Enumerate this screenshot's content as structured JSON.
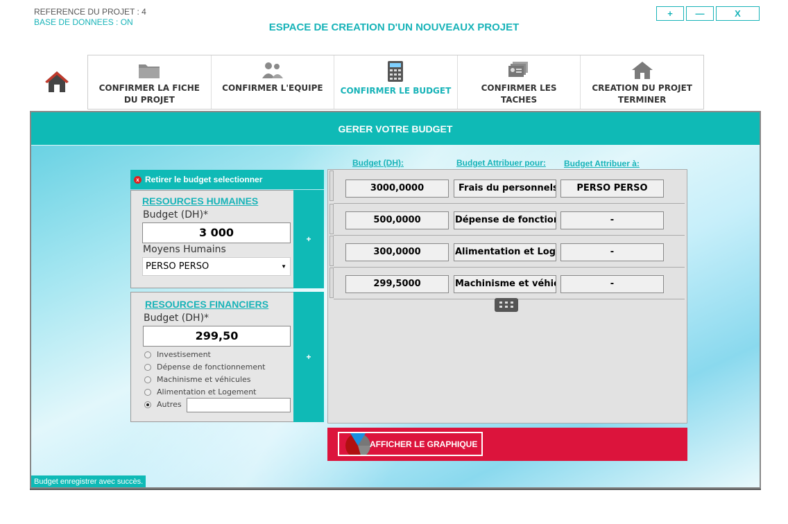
{
  "header": {
    "reference": "REFERENCE DU PROJET : 4",
    "database": "BASE DE DONNEES : ON",
    "title": "ESPACE DE CREATION D'UN NOUVEAUX PROJET"
  },
  "window_buttons": {
    "add": "+",
    "minimize": "—",
    "close": "X"
  },
  "nav": {
    "home_icon": "home-icon",
    "tabs": [
      {
        "label": "CONFIRMER LA FICHE DU PROJET",
        "icon": "folder-icon",
        "active": false
      },
      {
        "label": "CONFIRMER L'EQUIPE",
        "icon": "team-icon",
        "active": false
      },
      {
        "label": "CONFIRMER LE BUDGET",
        "icon": "calculator-icon",
        "active": true
      },
      {
        "label": "CONFIRMER LES TACHES",
        "icon": "tasks-icon",
        "active": false
      },
      {
        "label": "CREATION DU PROJET TERMINER",
        "icon": "house-icon",
        "active": false
      }
    ]
  },
  "panel": {
    "title": "GERER VOTRE BUDGET",
    "remove_label": "Retirer le budget selectionner",
    "human": {
      "title": "RESOURCES HUMAINES",
      "budget_label": "Budget (DH)*",
      "budget_value": "3 000",
      "means_label": "Moyens Humains",
      "means_value": "PERSO PERSO",
      "add": "+"
    },
    "financial": {
      "title": "RESOURCES FINANCIERS",
      "budget_label": "Budget (DH)*",
      "budget_value": "299,50",
      "options": [
        "Investisement",
        "Dépense de fonctionnement",
        "Machinisme et véhicules",
        "Alimentation et Logement",
        "Autres"
      ],
      "selected_option": "Autres",
      "other_value": "",
      "add": "+"
    },
    "table": {
      "headers": [
        "Budget (DH):",
        "Budget Attribuer pour:",
        "Budget Attribuer à:"
      ],
      "rows": [
        {
          "budget": "3000,0000",
          "for": "Frais du personnels",
          "to": "PERSO PERSO"
        },
        {
          "budget": "500,0000",
          "for": "Dépense de fonctionnement",
          "to": "-"
        },
        {
          "budget": "300,0000",
          "for": "Alimentation et Logement",
          "to": "-"
        },
        {
          "budget": "299,5000",
          "for": "Machinisme et véhicules",
          "to": "-"
        }
      ]
    },
    "chart_button": "AFFICHER LE GRAPHIQUE",
    "status": "Budget enregistrer avec succès."
  },
  "colors": {
    "teal": "#0fbab6",
    "accent": "#17b3b8",
    "crimson": "#dc143c"
  }
}
